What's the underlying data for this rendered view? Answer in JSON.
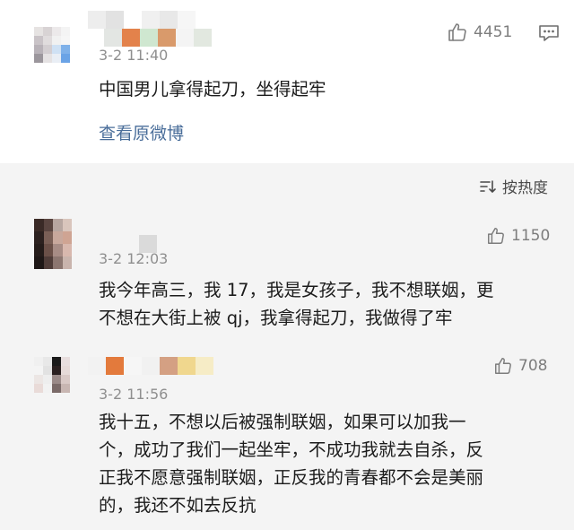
{
  "top_comment": {
    "time": "3-2 11:40",
    "likes": "4451",
    "text": "中国男儿拿得起刀，坐得起牢",
    "view_original": "查看原微博"
  },
  "sort": {
    "label": "按热度"
  },
  "comments": [
    {
      "time": "3-2 12:03",
      "likes": "1150",
      "text": "我今年高三，我 17，我是女孩子，我不想联姻，更不想在大街上被 qj，我拿得起刀，我做得了牢",
      "lines": [
        "我今年高三，我 17，我是女孩子，我不想联姻，更",
        "不想在大街上被 qj，我拿得起刀，我做得了牢"
      ]
    },
    {
      "time": "3-2 11:56",
      "likes": "708",
      "text": "我十五，不想以后被强制联姻，如果可以加我一个，成功了我们一起坐牢，不成功我就去自杀，反正我不愿意强制联姻，正反我的青春都不会是美丽的，我还不如去反抗",
      "lines": [
        "我十五，不想以后被强制联姻，如果可以加我一",
        "个，成功了我们一起坐牢，不成功我就去自杀，反",
        "正我不愿意强制联姻，正反我的青春都不会是美丽",
        "的，我还不如去反抗"
      ]
    }
  ],
  "icons": {
    "like": "thumbs-up-icon",
    "reply": "comment-icon",
    "sort": "sort-icon"
  }
}
